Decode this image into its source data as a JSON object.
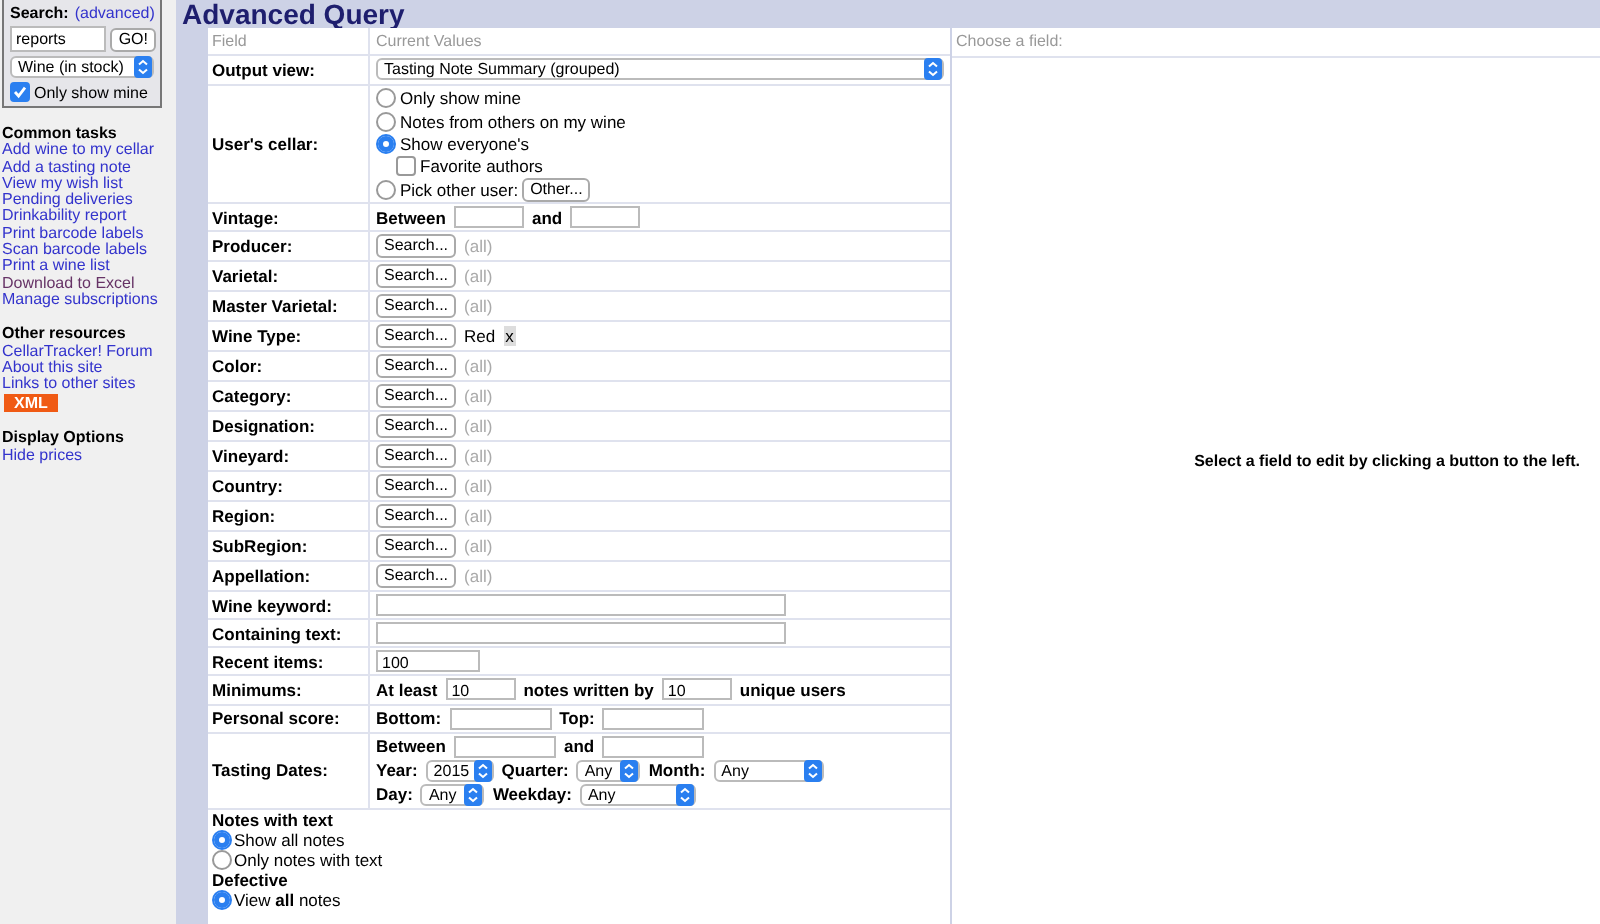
{
  "sidebar": {
    "search": {
      "label": "Search:",
      "link": "(advanced)",
      "value": "reports",
      "button": "GO!",
      "scope": "Wine (in stock)",
      "only_mine": {
        "label": "Only show mine",
        "checked": true
      }
    },
    "sections": [
      {
        "title": "Common tasks",
        "items": [
          {
            "kind": "link",
            "label": "Add wine to my cellar",
            "visited": false
          },
          {
            "kind": "link",
            "label": "Add a tasting note",
            "visited": false
          },
          {
            "kind": "link",
            "label": "View my wish list",
            "visited": false
          },
          {
            "kind": "link",
            "label": "Pending deliveries",
            "visited": false
          },
          {
            "kind": "link",
            "label": "Drinkability report",
            "visited": false
          },
          {
            "kind": "link",
            "label": "Print barcode labels",
            "visited": false
          },
          {
            "kind": "link",
            "label": "Scan barcode labels",
            "visited": false
          },
          {
            "kind": "link",
            "label": "Print a wine list",
            "visited": false
          },
          {
            "kind": "link",
            "label": "Download to Excel",
            "visited": true
          },
          {
            "kind": "link",
            "label": "Manage subscriptions",
            "visited": false
          }
        ]
      },
      {
        "title": "Other resources",
        "items": [
          {
            "kind": "link",
            "label": "CellarTracker! Forum",
            "visited": false
          },
          {
            "kind": "link",
            "label": "About this site",
            "visited": false
          },
          {
            "kind": "link",
            "label": "Links to other sites",
            "visited": false
          },
          {
            "kind": "badge",
            "label": "XML"
          }
        ]
      },
      {
        "title": "Display Options",
        "items": [
          {
            "kind": "link",
            "label": "Hide prices",
            "visited": false
          }
        ]
      }
    ]
  },
  "main": {
    "title": "Advanced Query",
    "columns": [
      "Field",
      "Current Values"
    ],
    "rows": [
      {
        "label": "Output view:",
        "kind": "select",
        "value": "Tasting Note Summary (grouped)"
      },
      {
        "label": "User's cellar:",
        "kind": "cellar",
        "options": [
          {
            "kind": "radio",
            "label": "Only show mine",
            "selected": false
          },
          {
            "kind": "radio",
            "label": "Notes from others on my wine",
            "selected": false
          },
          {
            "kind": "radio",
            "label": "Show everyone's",
            "selected": true
          },
          {
            "kind": "checkbox",
            "label": "Favorite authors",
            "checked": false
          },
          {
            "kind": "radio",
            "label": "Pick other user:",
            "selected": false,
            "button": "Other..."
          }
        ]
      },
      {
        "label": "Vintage:",
        "kind": "range",
        "words": [
          "Between",
          "and"
        ]
      },
      {
        "label": "Producer:",
        "kind": "search",
        "button": "Search...",
        "placeholder": "(all)"
      },
      {
        "label": "Varietal:",
        "kind": "search",
        "button": "Search...",
        "placeholder": "(all)"
      },
      {
        "label": "Master Varietal:",
        "kind": "search",
        "button": "Search...",
        "placeholder": "(all)"
      },
      {
        "label": "Wine Type:",
        "kind": "search",
        "button": "Search...",
        "value": "Red",
        "remove": "x"
      },
      {
        "label": "Color:",
        "kind": "search",
        "button": "Search...",
        "placeholder": "(all)"
      },
      {
        "label": "Category:",
        "kind": "search",
        "button": "Search...",
        "placeholder": "(all)"
      },
      {
        "label": "Designation:",
        "kind": "search",
        "button": "Search...",
        "placeholder": "(all)"
      },
      {
        "label": "Vineyard:",
        "kind": "search",
        "button": "Search...",
        "placeholder": "(all)"
      },
      {
        "label": "Country:",
        "kind": "search",
        "button": "Search...",
        "placeholder": "(all)"
      },
      {
        "label": "Region:",
        "kind": "search",
        "button": "Search...",
        "placeholder": "(all)"
      },
      {
        "label": "SubRegion:",
        "kind": "search",
        "button": "Search...",
        "placeholder": "(all)"
      },
      {
        "label": "Appellation:",
        "kind": "search",
        "button": "Search...",
        "placeholder": "(all)"
      },
      {
        "label": "Wine keyword:",
        "kind": "text"
      },
      {
        "label": "Containing text:",
        "kind": "text"
      },
      {
        "label": "Recent items:",
        "kind": "number",
        "value": "100"
      },
      {
        "label": "Minimums:",
        "kind": "minimums",
        "words": [
          "At least",
          "notes written by",
          "unique users"
        ],
        "values": [
          "10",
          "10"
        ]
      },
      {
        "label": "Personal score:",
        "kind": "score",
        "words": [
          "Bottom:",
          "Top:"
        ]
      },
      {
        "label": "Tasting Dates:",
        "kind": "dates",
        "words": [
          "Between",
          "and"
        ],
        "selects": [
          {
            "label": "Year:",
            "value": "2015"
          },
          {
            "label": "Quarter:",
            "value": "Any"
          },
          {
            "label": "Month:",
            "value": "Any"
          },
          {
            "label": "Day:",
            "value": "Any"
          },
          {
            "label": "Weekday:",
            "value": "Any"
          }
        ]
      }
    ],
    "groups": [
      {
        "title": "Notes with text",
        "options": [
          {
            "label": "Show all notes",
            "selected": true
          },
          {
            "label": "Only notes with text",
            "selected": false
          }
        ]
      },
      {
        "title": "Defective",
        "options": [
          {
            "label": "View **all** notes",
            "selected": true
          }
        ]
      }
    ]
  },
  "editor": {
    "header": "Choose a field:",
    "message": "Select a field to edit by clicking a button to the left."
  }
}
